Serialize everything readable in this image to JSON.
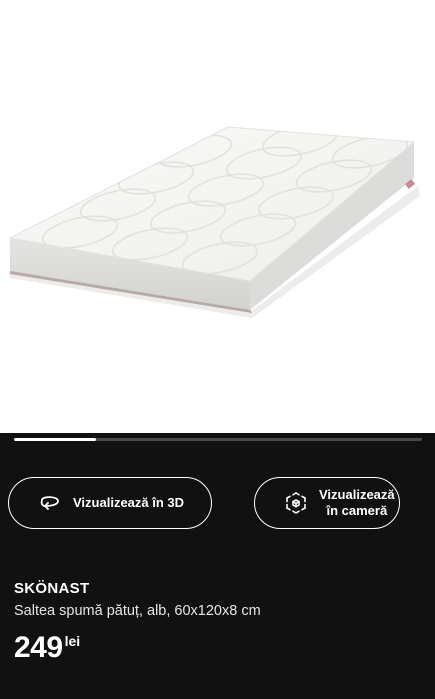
{
  "gallery": {
    "image_alt": "Saltea spumă pătuț, alb",
    "progress_fraction": 0.2
  },
  "actions": {
    "view_3d_label": "Vizualizează în 3D",
    "view_camera_label": "Vizualizează\nîn cameră",
    "view_3d_icon": "rotate-3d-icon",
    "view_camera_icon": "ar-cube-icon"
  },
  "product": {
    "name": "SKÖNAST",
    "description": "Saltea spumă pătuț, alb, 60x120x8 cm",
    "price": "249",
    "currency": "lei"
  },
  "colors": {
    "background": "#111111",
    "image_background": "#ffffff",
    "accent": "#ffffff"
  }
}
